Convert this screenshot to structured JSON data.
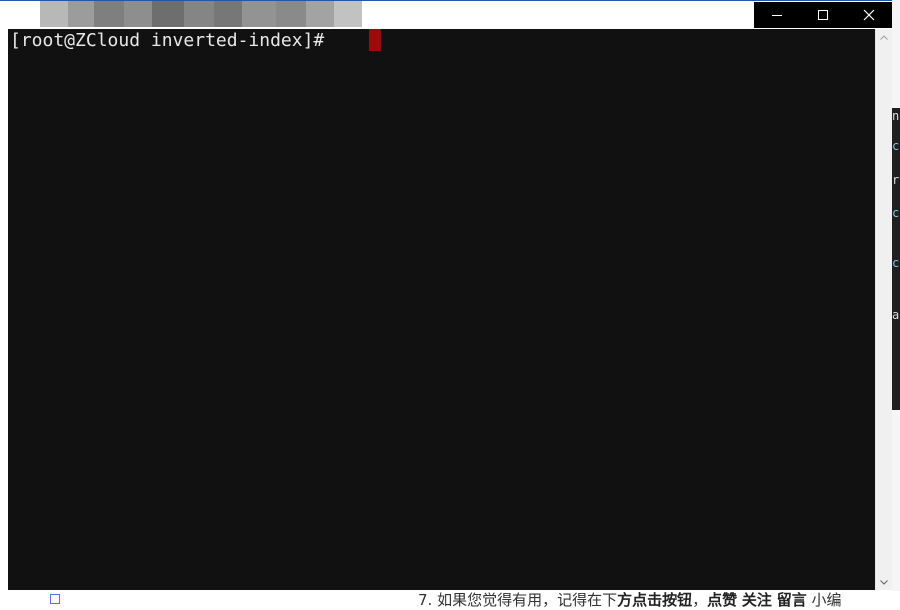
{
  "terminal": {
    "prompt": "[root@ZCloud inverted-index]#",
    "cursor_color": "#9a0c0c",
    "background_color": "#111111",
    "text_color": "#e8e8e8"
  },
  "window_controls": {
    "minimize_icon": "minimize-icon",
    "maximize_icon": "maximize-icon",
    "close_icon": "close-icon"
  },
  "scrollbar": {
    "up_icon": "scroll-up-arrow-icon",
    "down_icon": "scroll-down-arrow-icon"
  },
  "background_page": {
    "bottom_text_prefix": "7. 如果您觉得有用，记得在下",
    "bottom_text_bold": "方点击按钮",
    "bottom_text_rest": "，",
    "bottom_like": "点赞",
    "bottom_follow": "关注",
    "bottom_comment": "留言",
    "bottom_tail": "小编",
    "code_fragments": [
      "n",
      "cl",
      "re",
      "cl",
      "cl",
      "ac"
    ]
  }
}
